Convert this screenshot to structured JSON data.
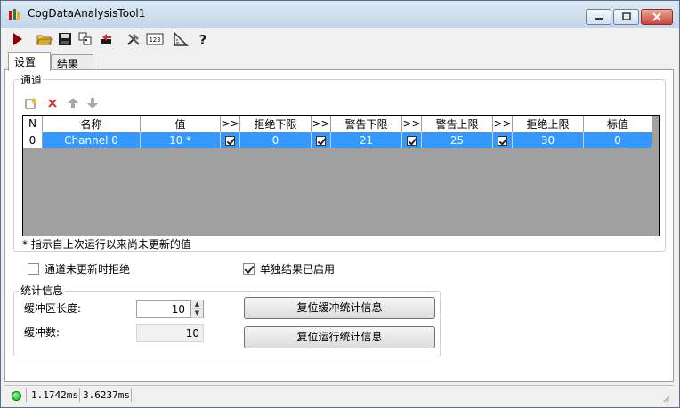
{
  "window": {
    "title": "CogDataAnalysisTool1"
  },
  "toolbar": {
    "buttons": [
      "run-icon",
      "open-icon",
      "save-icon",
      "copy-icon",
      "reset-icon",
      "tools-icon",
      "numeric-icon",
      "measure-icon",
      "help-icon"
    ],
    "help_glyph": "?",
    "numeric_glyph": "123"
  },
  "tabs": [
    {
      "label": "设置"
    },
    {
      "label": "结果"
    }
  ],
  "channel_group": {
    "label": "通道",
    "grid": {
      "headers": [
        "N",
        "名称",
        "值",
        ">>",
        "拒绝下限",
        ">>",
        "警告下限",
        ">>",
        "警告上限",
        ">>",
        "拒绝上限",
        "标值"
      ],
      "rows": [
        {
          "n": "0",
          "name": "Channel 0",
          "value": "10 *",
          "c1": true,
          "reject_low": "0",
          "c2": true,
          "warn_low": "21",
          "c3": true,
          "warn_high": "25",
          "c4": true,
          "reject_high": "30",
          "nominal": "0"
        }
      ]
    },
    "note": "* 指示自上次运行以来尚未更新的值"
  },
  "options": {
    "reject_not_updated": {
      "label": "通道未更新时拒绝",
      "checked": false
    },
    "independent_results": {
      "label": "单独结果已启用",
      "checked": true
    }
  },
  "stats": {
    "label": "统计信息",
    "buffer_length_label": "缓冲区长度:",
    "buffer_length_value": "10",
    "buffer_count_label": "缓冲数:",
    "buffer_count_value": "10",
    "reset_buffer_button": "复位缓冲统计信息",
    "reset_run_button": "复位运行统计信息"
  },
  "status": {
    "time1": "1.1742ms",
    "time2": "3.6237ms",
    "led_color": "#0ab00a"
  }
}
